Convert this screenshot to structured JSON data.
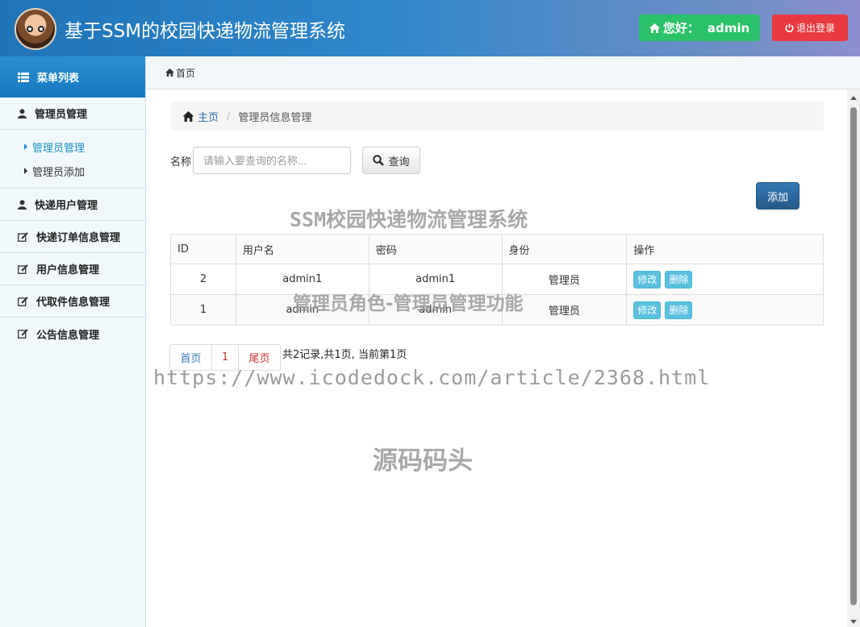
{
  "header": {
    "title": "基于SSM的校园快递物流管理系统",
    "greeting": "您好：",
    "username": "admin",
    "logout_label": "退出登录"
  },
  "sidebar": {
    "menu_title": "菜单列表",
    "groups": [
      {
        "label": "管理员管理",
        "icon": "user-icon",
        "items": [
          {
            "label": "管理员管理",
            "active": true
          },
          {
            "label": "管理员添加",
            "active": false
          }
        ]
      },
      {
        "label": "快递用户管理",
        "icon": "user-icon"
      },
      {
        "label": "快递订单信息管理",
        "icon": "edit-icon"
      },
      {
        "label": "用户信息管理",
        "icon": "edit-icon"
      },
      {
        "label": "代取件信息管理",
        "icon": "edit-icon"
      },
      {
        "label": "公告信息管理",
        "icon": "edit-icon"
      }
    ]
  },
  "topbar": {
    "label": "首页"
  },
  "breadcrumb": {
    "home": "主页",
    "current": "管理员信息管理"
  },
  "search": {
    "label": "名称",
    "placeholder": "请输入要查询的名称...",
    "button": "查询"
  },
  "add_label": "添加",
  "table": {
    "headers": [
      "ID",
      "用户名",
      "密码",
      "身份",
      "操作"
    ],
    "rows": [
      {
        "id": "2",
        "username": "admin1",
        "password": "admin1",
        "role": "管理员",
        "edit": "修改",
        "delete": "删除"
      },
      {
        "id": "1",
        "username": "admin",
        "password": "admin",
        "role": "管理员",
        "edit": "修改",
        "delete": "删除"
      }
    ]
  },
  "pagination": {
    "first": "首页",
    "current": "1",
    "last": "尾页",
    "info": "共2记录,共1页, 当前第1页"
  },
  "watermarks": {
    "w1": "SSM校园快递物流管理系统",
    "w2": "管理员角色-管理员管理功能",
    "w3": "https://www.icodedock.com/article/2368.html",
    "w4": "源码码头"
  },
  "colors": {
    "header_start": "#1f74b8",
    "greet": "#2bc26a",
    "logout": "#e83a3f",
    "add": "#337ab7",
    "op": "#5bc0de"
  }
}
